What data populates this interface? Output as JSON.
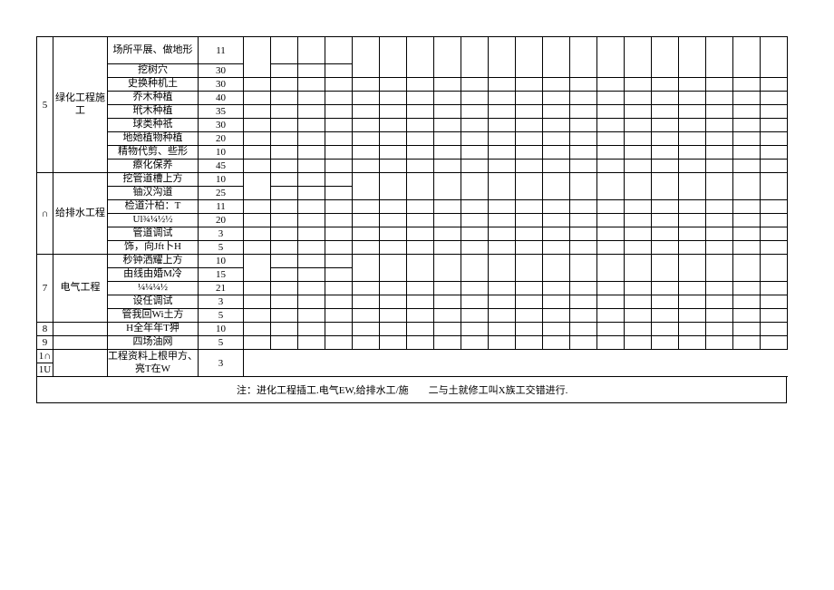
{
  "sections": [
    {
      "num": "5",
      "name": "绿化工程施工"
    },
    {
      "num": "∩",
      "name": "给排水工程"
    },
    {
      "num": "7",
      "name": "电气工程"
    }
  ],
  "rows": {
    "r1": {
      "desc": "场所平展、做地形",
      "val": "11"
    },
    "r2": {
      "desc": "挖树穴",
      "val": "30"
    },
    "r3": {
      "desc": "史换种机土",
      "val": "30"
    },
    "r4": {
      "desc": "乔木种植",
      "val": "40"
    },
    "r5": {
      "desc": "玳木种植",
      "val": "35"
    },
    "r6": {
      "desc": "球类种祇",
      "val": "30"
    },
    "r7": {
      "desc": "地她植物种植",
      "val": "20"
    },
    "r8": {
      "desc": "精物代剪、些形",
      "val": "10"
    },
    "r9": {
      "desc": "瘵化保养",
      "val": "45"
    },
    "r10": {
      "desc": "挖管道槽上方",
      "val": "10"
    },
    "r11": {
      "desc": "铀汉沟道",
      "val": "25"
    },
    "r12": {
      "desc": "检道汁柏：T",
      "val": "11"
    },
    "r13": {
      "desc": "Ul¾¼½½",
      "val": "20"
    },
    "r14": {
      "desc": "管道调试",
      "val": "3"
    },
    "r15": {
      "desc": "饰，向Jft卜H",
      "val": "5"
    },
    "r16": {
      "desc": "秒钟洒耀上方",
      "val": "10"
    },
    "r17": {
      "desc": "由线由婚M冷",
      "val": "15"
    },
    "r18": {
      "desc": "¼¼¼½",
      "val": "21"
    },
    "r19": {
      "desc": "设任调试",
      "val": "3"
    },
    "r20": {
      "desc": "管我回Wi土方",
      "val": "5"
    },
    "r21": {
      "num": "8",
      "desc": "H全年年T狎",
      "val": "10"
    },
    "r22": {
      "num": "9",
      "desc": "四场油网",
      "val": "5"
    },
    "r23": {
      "num": "1∩",
      "desc": "工程资料上根甲方、亮T在W",
      "val": "3"
    },
    "r23b": {
      "num": "1U"
    }
  },
  "footer": "注：进化工程插工.电气EW,给排水工/施　　二与土就修工叫X族工交错进行."
}
